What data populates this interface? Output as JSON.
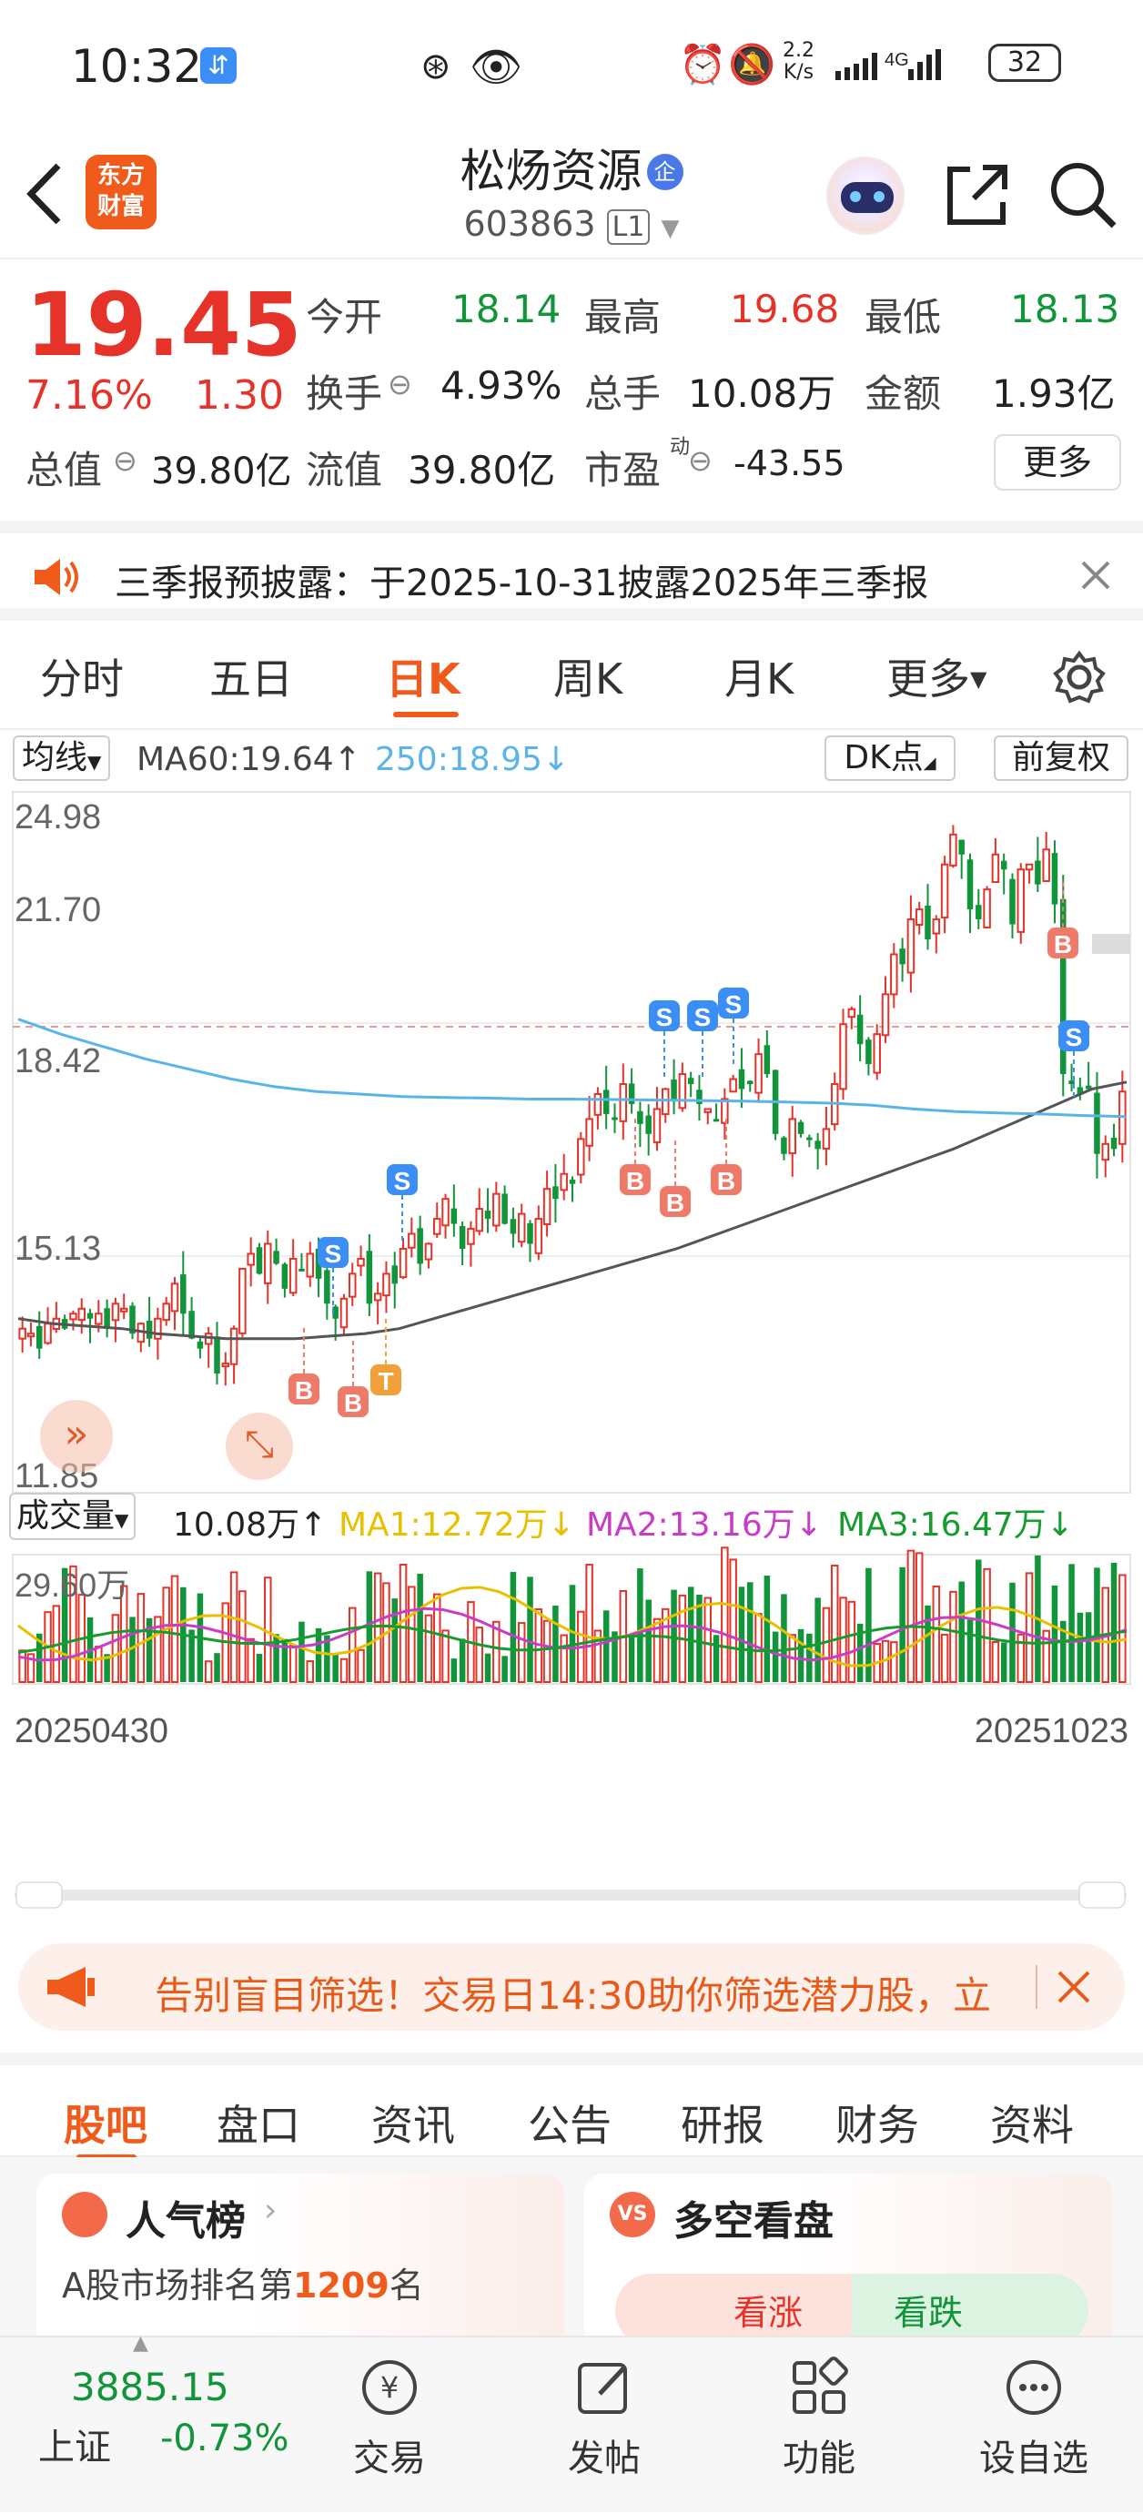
{
  "status_bar": {
    "time": "10:32",
    "net_speed_top": "2.2",
    "net_speed_bottom": "K/s",
    "network": "4G",
    "battery": "32"
  },
  "header": {
    "logo_line1": "东方",
    "logo_line2": "财富",
    "stock_name": "松炀资源",
    "badge": "企",
    "code": "603863",
    "level": "L1"
  },
  "quote": {
    "price": "19.45",
    "change_pct": "7.16%",
    "change": "1.30",
    "open_label": "今开",
    "open": "18.14",
    "high_label": "最高",
    "high": "19.68",
    "low_label": "最低",
    "low": "18.13",
    "turnover_label": "换手",
    "turnover": "4.93%",
    "vol_label": "总手",
    "vol": "10.08万",
    "amount_label": "金额",
    "amount": "1.93亿",
    "mktcap_label": "总值",
    "mktcap": "39.80亿",
    "float_label": "流值",
    "float": "39.80亿",
    "pe_label": "市盈",
    "pe_sup": "动",
    "pe": "-43.55",
    "more": "更多"
  },
  "notice": {
    "text": "三季报预披露：于2025-10-31披露2025年三季报"
  },
  "period_tabs": [
    "分时",
    "五日",
    "日K",
    "周K",
    "月K",
    "更多"
  ],
  "active_period": 2,
  "indicator_bar": {
    "ma_select": "均线",
    "ma60": "MA60:19.64↑",
    "ma250": "250:18.95↓",
    "dk": "DK点",
    "adjust": "前复权"
  },
  "price_axis": [
    "24.98",
    "21.70",
    "18.42",
    "15.13",
    "11.85"
  ],
  "volume_bar": {
    "select": "成交量",
    "vol": "10.08万↑",
    "ma1": "MA1:12.72万↓",
    "ma2": "MA2:13.16万↓",
    "ma3": "MA3:16.47万↓",
    "axis_top": "29.60万"
  },
  "date_range": {
    "start": "20250430",
    "end": "20251023"
  },
  "signal_labels": {
    "buy": "B",
    "sell": "S",
    "t": "T"
  },
  "colors": {
    "up": "#e6332a",
    "down": "#11953a",
    "ma60": "#555555",
    "ma250": "#5ab4e8",
    "ma1": "#e8c000",
    "ma2": "#c83cc8",
    "ma3": "#169c2e",
    "brand": "#f05a1a"
  },
  "chart_data": {
    "type": "candlestick",
    "price_ylim": [
      11.85,
      24.98
    ],
    "close": [
      14.7,
      14.6,
      14.3,
      14.8,
      14.9,
      14.7,
      15.0,
      15.1,
      14.9,
      15.0,
      14.7,
      15.2,
      15.1,
      14.6,
      14.8,
      14.5,
      14.9,
      15.2,
      15.6,
      15.0,
      14.5,
      14.3,
      14.6,
      13.8,
      14.0,
      14.7,
      15.9,
      16.2,
      15.8,
      16.4,
      16.0,
      15.5,
      16.1,
      15.9,
      16.2,
      15.7,
      15.2,
      14.9,
      15.3,
      15.8,
      16.1,
      15.2,
      15.4,
      15.8,
      15.6,
      16.3,
      16.6,
      16.0,
      16.4,
      16.9,
      17.3,
      16.8,
      16.3,
      16.7,
      17.1,
      16.9,
      17.4,
      16.8,
      16.6,
      17.0,
      16.4,
      16.9,
      17.5,
      17.3,
      17.8,
      17.6,
      18.5,
      18.9,
      19.4,
      19.0,
      18.9,
      19.6,
      19.2,
      18.8,
      18.6,
      19.1,
      19.5,
      19.3,
      19.8,
      19.6,
      19.2,
      19.1,
      18.9,
      19.3,
      19.7,
      19.5,
      19.6,
      20.2,
      19.8,
      18.6,
      18.2,
      18.9,
      18.6,
      18.5,
      18.3,
      18.7,
      19.6,
      20.8,
      21.1,
      20.4,
      20.0,
      20.6,
      21.4,
      22.2,
      22.0,
      22.9,
      23.1,
      22.5,
      22.9,
      24.0,
      24.6,
      24.2,
      23.1,
      22.9,
      23.5,
      24.2,
      23.9,
      22.8,
      23.9,
      24.0,
      23.6,
      24.3,
      23.2,
      19.8,
      19.6,
      19.4,
      19.5,
      18.2,
      18.4,
      18.3,
      19.45
    ],
    "ma60": [
      14.9,
      14.8,
      14.75,
      14.7,
      14.6,
      14.55,
      14.5,
      14.5,
      14.5,
      14.55,
      14.6,
      14.7,
      14.9,
      15.1,
      15.3,
      15.5,
      15.7,
      15.9,
      16.1,
      16.3,
      16.55,
      16.8,
      17.05,
      17.3,
      17.55,
      17.8,
      18.05,
      18.3,
      18.6,
      18.9,
      19.2,
      19.5,
      19.64
    ],
    "ma250": [
      20.9,
      20.6,
      20.35,
      20.1,
      19.9,
      19.7,
      19.55,
      19.45,
      19.4,
      19.35,
      19.33,
      19.32,
      19.3,
      19.3,
      19.29,
      19.28,
      19.27,
      19.26,
      19.24,
      19.22,
      19.18,
      19.1,
      19.05,
      19.02,
      19.0,
      18.97,
      18.95
    ],
    "vol_max": "29.60万",
    "signals": [
      {
        "type": "S",
        "price_label": "15.13"
      },
      {
        "type": "S"
      },
      {
        "type": "B"
      },
      {
        "type": "B"
      },
      {
        "type": "T"
      },
      {
        "type": "S"
      },
      {
        "type": "S"
      },
      {
        "type": "S"
      },
      {
        "type": "B"
      },
      {
        "type": "B"
      },
      {
        "type": "B"
      },
      {
        "type": "S"
      },
      {
        "type": "B"
      }
    ]
  },
  "promo": {
    "text": "告别盲目筛选！交易日14:30助你筛选潜力股，立"
  },
  "sub_tabs": [
    "股吧",
    "盘口",
    "资讯",
    "公告",
    "研报",
    "财务",
    "资料"
  ],
  "cards": {
    "popularity_title": "人气榜",
    "rank_prefix": "A股市场排名第",
    "rank": "1209",
    "rank_suffix": "名",
    "duel_title": "多空看盘",
    "bull": "看涨",
    "bear": "看跌"
  },
  "bottom_bar": {
    "index_value": "3885.15",
    "index_name": "上证",
    "index_change": "-0.73%",
    "items": [
      "交易",
      "发帖",
      "功能",
      "设自选"
    ]
  }
}
